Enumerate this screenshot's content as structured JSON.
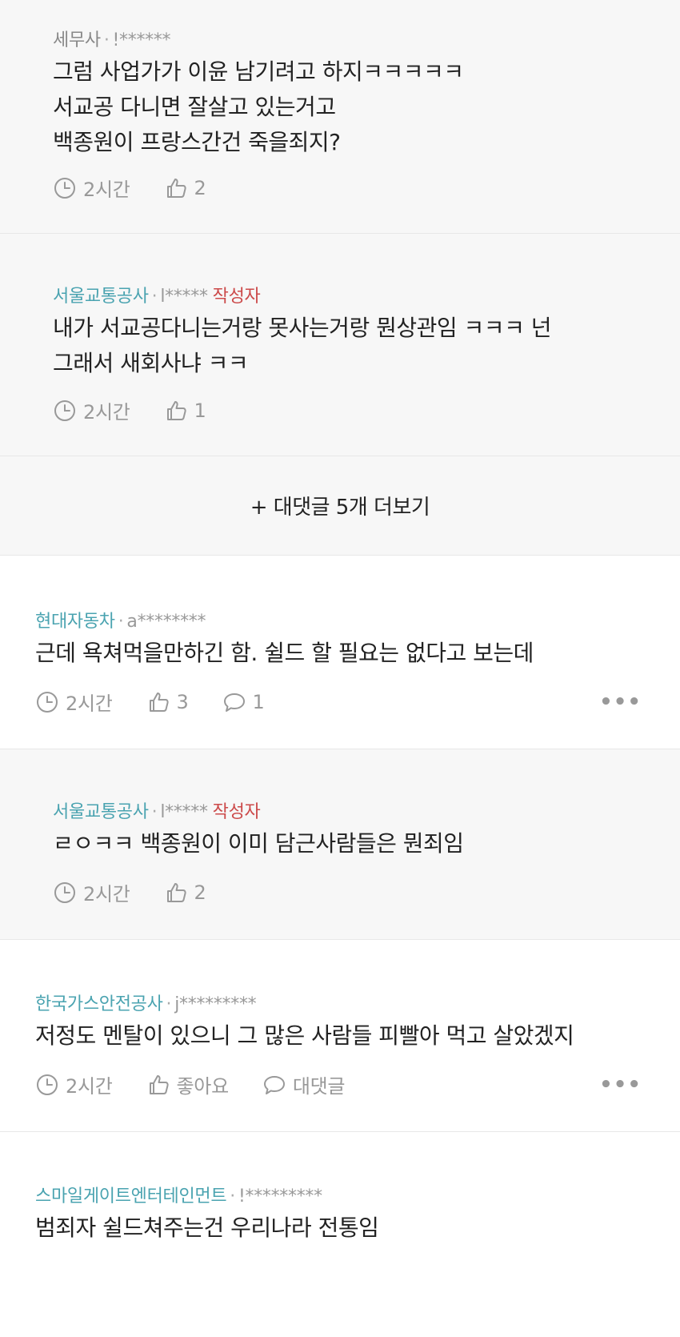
{
  "comments": [
    {
      "company": "세무사",
      "user": "!******",
      "author_badge": "",
      "lines": [
        "그럼 사업가가 이윤 남기려고 하지ㅋㅋㅋㅋㅋ",
        "서교공 다니면 잘살고 있는거고",
        "백종원이 프랑스간건 죽을죄지?"
      ],
      "time": "2시간",
      "likes": "2",
      "replies": ""
    },
    {
      "company": "서울교통공사",
      "user": "l*****",
      "author_badge": "작성자",
      "lines": [
        "내가 서교공다니는거랑 못사는거랑 뭔상관임 ㅋㅋㅋ 넌",
        "그래서 새회사냐 ㅋㅋ"
      ],
      "time": "2시간",
      "likes": "1",
      "replies": ""
    },
    {
      "company": "현대자동차",
      "user": "a********",
      "author_badge": "",
      "lines": [
        "근데 욕쳐먹을만하긴 함. 쉴드 할 필요는 없다고 보는데"
      ],
      "time": "2시간",
      "likes": "3",
      "replies": "1"
    },
    {
      "company": "서울교통공사",
      "user": "l*****",
      "author_badge": "작성자",
      "lines": [
        "ㄹㅇㅋㅋ 백종원이 이미 담근사람들은 뭔죄임"
      ],
      "time": "2시간",
      "likes": "2",
      "replies": ""
    },
    {
      "company": "한국가스안전공사",
      "user": "j*********",
      "author_badge": "",
      "lines": [
        "저정도 멘탈이 있으니 그 많은 사람들 피빨아 먹고 살았겠지"
      ],
      "time": "2시간",
      "likes": "좋아요",
      "replies": "대댓글"
    },
    {
      "company": "스마일게이트엔터테인먼트",
      "user": "!*********",
      "author_badge": "",
      "lines": [
        "범죄자 쉴드쳐주는건 우리나라 전통임"
      ],
      "time": "",
      "likes": "",
      "replies": ""
    }
  ],
  "more_replies_label": "+ 대댓글 5개 더보기",
  "more_menu": "•••",
  "dot_separator": "·",
  "icons": {
    "time": "clock-icon",
    "like": "thumbs-up-icon",
    "reply": "speech-bubble-icon",
    "menu": "more-horizontal-icon"
  },
  "colors": {
    "company": "#4aa3b0",
    "author_badge": "#cc4a4a",
    "meta_gray": "#999999",
    "reply_bg": "#f7f7f7"
  }
}
